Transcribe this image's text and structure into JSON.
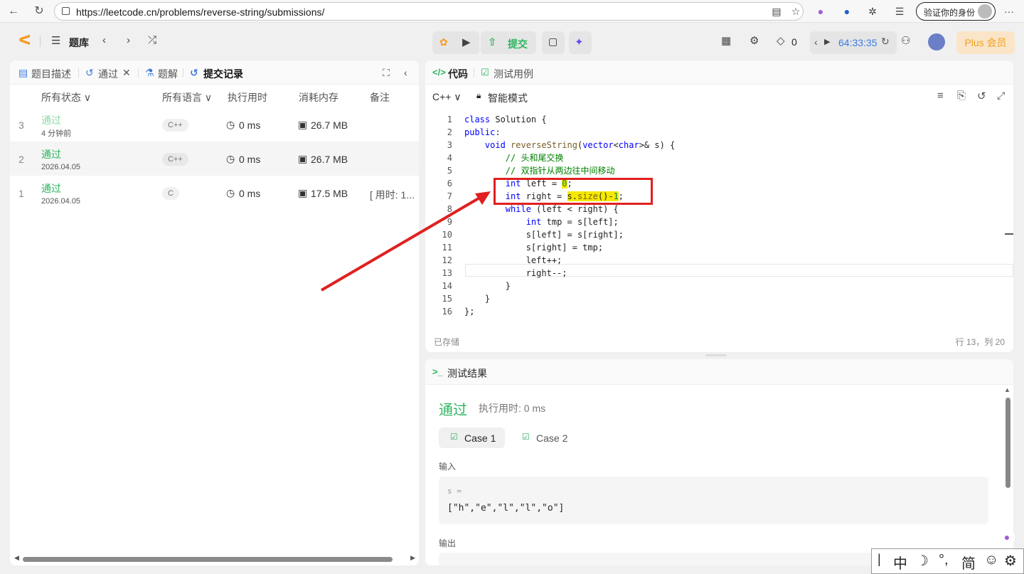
{
  "browser": {
    "url": "https://leetcode.cn/problems/reverse-string/submissions/",
    "verify_label": "验证你的身份"
  },
  "header": {
    "problem_bank": "题库",
    "submit_label": "提交",
    "streak": "0",
    "timer": "64:33:35",
    "plus_label": "Plus 会员"
  },
  "left_tabs": [
    {
      "label": "题目描述"
    },
    {
      "label": "通过"
    },
    {
      "label": "题解"
    },
    {
      "label": "提交记录"
    }
  ],
  "columns": [
    "所有状态 ∨",
    "所有语言 ∨",
    "执行用时",
    "消耗内存",
    "备注"
  ],
  "submissions": [
    {
      "index": "3",
      "status": "通过",
      "time": "4 分钟前",
      "lang": "C++",
      "runtime": "0 ms",
      "memory": "26.7 MB",
      "note": ""
    },
    {
      "index": "2",
      "status": "通过",
      "time": "2026.04.05",
      "lang": "C++",
      "runtime": "0 ms",
      "memory": "26.7 MB",
      "note": ""
    },
    {
      "index": "1",
      "status": "通过",
      "time": "2026.04.05",
      "lang": "C",
      "runtime": "0 ms",
      "memory": "17.5 MB",
      "note": "[ 用时: 1..."
    }
  ],
  "editor": {
    "tab_code": "代码",
    "tab_testcase": "测试用例",
    "language": "C++ ∨",
    "mode": "智能模式",
    "saved": "已存储",
    "cursor": "行 13，列 20",
    "lines": [
      "1",
      "2",
      "3",
      "4",
      "5",
      "6",
      "7",
      "8",
      "9",
      "10",
      "11",
      "12",
      "13",
      "14",
      "15",
      "16"
    ]
  },
  "results": {
    "title": "测试结果",
    "status": "通过",
    "runtime": "执行用时: 0 ms",
    "case1": "Case 1",
    "case2": "Case 2",
    "input_label": "输入",
    "var_name": "s =",
    "input_value": "[\"h\",\"e\",\"l\",\"l\",\"o\"]",
    "output_label": "输出"
  },
  "ime": {
    "mode": "中",
    "simplified": "简"
  }
}
